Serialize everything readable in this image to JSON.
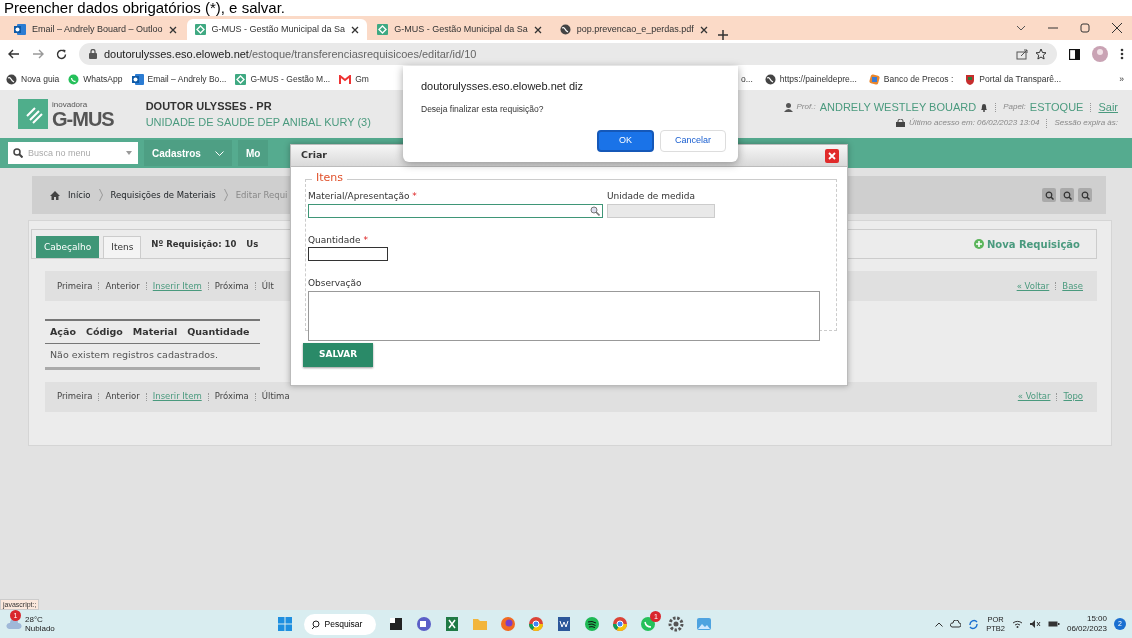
{
  "caption": "Preencher dados obrigatórios (*), e salvar.",
  "browser": {
    "tabs": [
      {
        "kind": "mail",
        "title": "Email – Andrely Bouard – Outloo",
        "selected": false
      },
      {
        "kind": "app",
        "title": "G-MUS - Gestão Municipal da Sa",
        "selected": true
      },
      {
        "kind": "app",
        "title": "G-MUS - Gestão Municipal da Sa",
        "selected": false
      },
      {
        "kind": "web",
        "title": "pop.prevencao_e_perdas.pdf",
        "selected": false
      }
    ],
    "address": {
      "domain": "doutorulysses.eso.eloweb.net",
      "path": "/estoque/transferenciasrequisicoes/editar/id/10"
    },
    "bookmarks_left": [
      {
        "kind": "web",
        "label": "Nova guia"
      },
      {
        "kind": "chat",
        "label": "WhatsApp"
      },
      {
        "kind": "mail",
        "label": "Email – Andrely Bo..."
      },
      {
        "kind": "app",
        "label": "G-MUS - Gestão M..."
      },
      {
        "kind": "gmail",
        "label": "Gm"
      }
    ],
    "bookmarks_right": [
      {
        "kind": "none",
        "label": "o..."
      },
      {
        "kind": "web",
        "label": "https://paineldepre..."
      },
      {
        "kind": "finance",
        "label": "Banco de Precos :"
      },
      {
        "kind": "crest",
        "label": "Portal da Transparê..."
      }
    ],
    "bookmarks_more": "»"
  },
  "header": {
    "brand": {
      "tagline": "inovadora",
      "name": "G-MUS"
    },
    "org": {
      "city": "DOUTOR ULYSSES - PR",
      "unit": "UNIDADE DE SAUDE DEP ANIBAL KURY (3)"
    },
    "user": {
      "prof_label": "Prof.:",
      "name": "ANDRELY WESTLEY BOUARD",
      "role_label": "Papel:",
      "role": "ESTOQUE",
      "logout": "Sair",
      "last_access": "Último acesso em: 06/02/2023 13:04",
      "session": "Sessão expira às:"
    }
  },
  "nav": {
    "search_placeholder": "Busca no menu",
    "menus": [
      {
        "label": "Cadastros",
        "dropdown": true
      },
      {
        "label": "Mo",
        "dropdown": false
      }
    ]
  },
  "breadcrumb": [
    {
      "label": "Início",
      "link": true
    },
    {
      "label": "Requisições de Materiais",
      "link": true
    },
    {
      "label": "Editar Requi",
      "link": false
    }
  ],
  "page_tabs": [
    {
      "label": "Cabeçalho",
      "selected": true
    },
    {
      "label": "Itens",
      "selected": false
    }
  ],
  "info": [
    "Nº Requisição: 10",
    "Us"
  ],
  "new_request": "Nova Requisição",
  "pager_top": {
    "items": [
      {
        "label": "Primeira",
        "enabled": false
      },
      {
        "label": "Anterior",
        "enabled": false
      },
      {
        "label": "Inserir Item",
        "enabled": true
      },
      {
        "label": "Próxima",
        "enabled": false
      },
      {
        "label": "Últ",
        "enabled": false
      }
    ],
    "right": [
      "« Voltar",
      "Base"
    ]
  },
  "table": {
    "columns": [
      "Ação",
      "Código",
      "Material",
      "Quantidade"
    ],
    "empty": "Não existem registros cadastrados."
  },
  "pager_bottom": {
    "items": [
      {
        "label": "Primeira",
        "enabled": false
      },
      {
        "label": "Anterior",
        "enabled": false
      },
      {
        "label": "Inserir Item",
        "enabled": true
      },
      {
        "label": "Próxima",
        "enabled": false
      },
      {
        "label": "Última",
        "enabled": false
      }
    ],
    "right": [
      "« Voltar",
      "Topo"
    ]
  },
  "modal": {
    "title": "Criar",
    "legend": "Itens",
    "rows": [
      [
        {
          "kind": "lookup",
          "label": "Material/Apresentação",
          "mark": "*",
          "focused": true
        },
        {
          "kind": "readonly",
          "label": "Unidade de medida",
          "focused": false
        }
      ],
      [
        {
          "kind": "text",
          "label": "Quantidade",
          "mark": "*",
          "focused": false
        }
      ],
      [
        {
          "kind": "textarea",
          "label": "Observação",
          "focused": false
        }
      ]
    ],
    "submit": "SALVAR"
  },
  "alert": {
    "origin": "doutorulysses.eso.eloweb.net diz",
    "message": "Deseja finalizar esta requisição?",
    "buttons": [
      {
        "label": "OK",
        "primary": true
      },
      {
        "label": "Cancelar",
        "primary": false
      }
    ]
  },
  "status_text": "javascript:;",
  "taskbar": {
    "weather": {
      "badge": "1",
      "temp": "28°C",
      "desc": "Nublado"
    },
    "search": "Pesquisar",
    "apps": [
      {
        "kind": "square"
      },
      {
        "kind": "video"
      },
      {
        "kind": "sheet"
      },
      {
        "kind": "folder"
      },
      {
        "kind": "fox"
      },
      {
        "kind": "chrome"
      },
      {
        "kind": "doc"
      },
      {
        "kind": "music"
      },
      {
        "kind": "chrome"
      },
      {
        "kind": "chat",
        "badge": "1"
      },
      {
        "kind": "gear"
      },
      {
        "kind": "photo"
      }
    ],
    "tray": {
      "lang": "POR",
      "layout": "PTB2",
      "time": "15:00",
      "date": "06/02/2023",
      "notifications": "2"
    }
  }
}
